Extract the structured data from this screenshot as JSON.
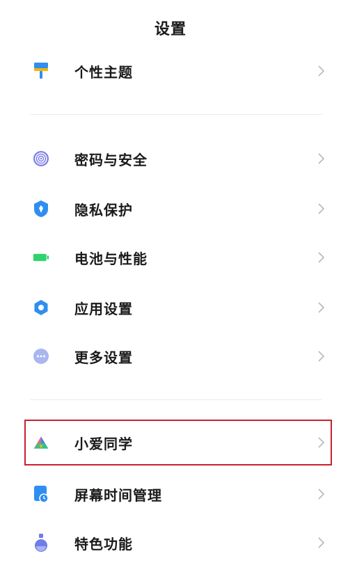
{
  "header": {
    "title": "设置"
  },
  "groups": [
    {
      "items": [
        {
          "label": "个性主题",
          "icon": "paint-roller-icon"
        }
      ]
    },
    {
      "items": [
        {
          "label": "密码与安全",
          "icon": "fingerprint-icon"
        },
        {
          "label": "隐私保护",
          "icon": "shield-icon"
        },
        {
          "label": "电池与性能",
          "icon": "battery-icon"
        },
        {
          "label": "应用设置",
          "icon": "gear-icon"
        },
        {
          "label": "更多设置",
          "icon": "more-dots-icon"
        }
      ]
    },
    {
      "items": [
        {
          "label": "小爱同学",
          "icon": "xiaoai-assistant-icon"
        },
        {
          "label": "屏幕时间管理",
          "icon": "screen-time-icon"
        },
        {
          "label": "特色功能",
          "icon": "flask-icon"
        }
      ]
    }
  ],
  "colors": {
    "theme_yellow": "#f5b400",
    "theme_blue": "#2f8ef0",
    "fingerprint": "#7c7de8",
    "shield": "#2f8ef0",
    "battery": "#2fd36b",
    "gear": "#2f8ef0",
    "more": "#a9b6ef",
    "highlight_border": "#c8202c",
    "chevron": "#b8b8b8"
  }
}
